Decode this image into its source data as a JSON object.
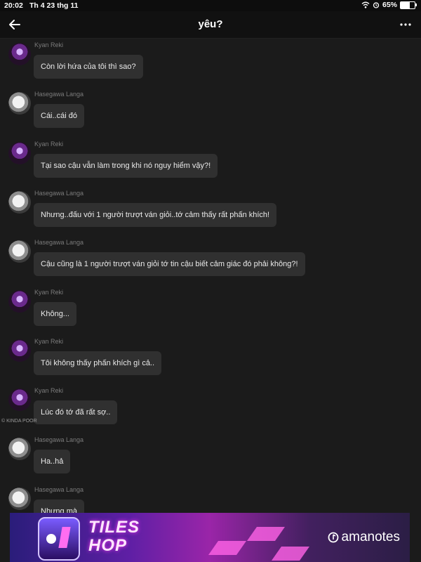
{
  "status_bar": {
    "time": "20:02",
    "date": "Th 4 23 thg 11",
    "battery": "65%",
    "battery_fraction": 0.65
  },
  "header": {
    "title": "yêu?"
  },
  "messages": [
    {
      "sender": "Kyan Reki",
      "avatar": "kyan",
      "text": "Còn lời hứa của tôi thì sao?"
    },
    {
      "sender": "Hasegawa Langa",
      "avatar": "langa",
      "text": "Cái..cái đó"
    },
    {
      "sender": "Kyan Reki",
      "avatar": "kyan",
      "text": "Tại sao cậu vẫn làm trong khi nó nguy hiểm vậy?!"
    },
    {
      "sender": "Hasegawa Langa",
      "avatar": "langa",
      "text": "Nhưng..đấu với 1 người trượt ván giỏi..tớ cảm thấy rất phấn khích!"
    },
    {
      "sender": "Hasegawa Langa",
      "avatar": "langa",
      "text": "Cậu cũng là 1 người trượt ván giỏi tớ tin cậu biết cảm giác đó phải không?!"
    },
    {
      "sender": "Kyan Reki",
      "avatar": "kyan",
      "text": "Không..."
    },
    {
      "sender": "Kyan Reki",
      "avatar": "kyan",
      "text": "Tôi không thấy phấn khích gì cả.."
    },
    {
      "sender": "Kyan Reki",
      "avatar": "kyan",
      "text": "Lúc đó tớ đã rất sợ.."
    },
    {
      "sender": "Hasegawa Langa",
      "avatar": "langa",
      "text": "Ha..hả"
    },
    {
      "sender": "Hasegawa Langa",
      "avatar": "langa",
      "text": "Nhưng mà"
    }
  ],
  "watermark": "© KINDA POOR",
  "ad": {
    "game_title_line1": "TILES",
    "game_title_line2": "HOP",
    "brand": "amanotes"
  },
  "icons": {
    "back": "arrow-left-icon",
    "more": "more-horizontal-icon",
    "wifi": "wifi-icon",
    "alarm": "alarm-icon",
    "battery": "battery-icon"
  }
}
